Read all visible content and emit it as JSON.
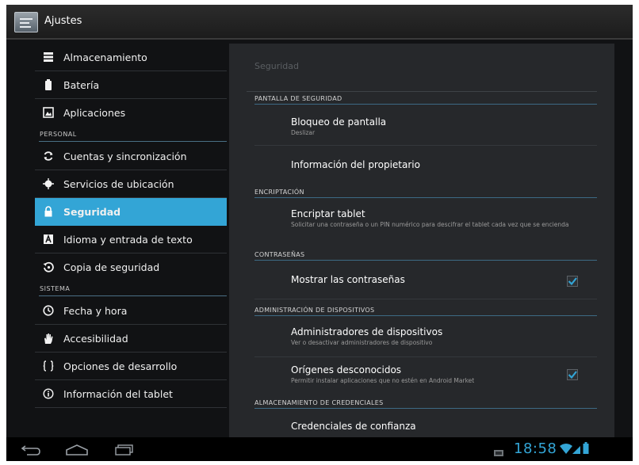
{
  "app": {
    "title": "Ajustes"
  },
  "nav": {
    "items": [
      {
        "label": "Almacenamiento",
        "icon": "storage-icon"
      },
      {
        "label": "Batería",
        "icon": "battery-icon"
      },
      {
        "label": "Aplicaciones",
        "icon": "apps-icon"
      },
      {
        "label": "Cuentas y sincronización",
        "icon": "sync-icon"
      },
      {
        "label": "Servicios de ubicación",
        "icon": "location-icon"
      },
      {
        "label": "Seguridad",
        "icon": "lock-icon",
        "selected": true
      },
      {
        "label": "Idioma y entrada de texto",
        "icon": "language-icon"
      },
      {
        "label": "Copia de seguridad",
        "icon": "backup-icon"
      },
      {
        "label": "Fecha y hora",
        "icon": "clock-icon"
      },
      {
        "label": "Accesibilidad",
        "icon": "hand-icon"
      },
      {
        "label": "Opciones de desarrollo",
        "icon": "braces-icon"
      },
      {
        "label": "Información del tablet",
        "icon": "info-icon"
      }
    ],
    "headers": {
      "personal": "PERSONAL",
      "sistema": "SISTEMA"
    }
  },
  "panel": {
    "title": "Seguridad",
    "sections": {
      "pantalla": "PANTALLA DE SEGURIDAD",
      "encriptacion": "ENCRIPTACIÓN",
      "contrasenas": "CONTRASEÑAS",
      "administracion": "ADMINISTRACIÓN DE DISPOSITIVOS",
      "almacenamiento": "ALMACENAMIENTO DE CREDENCIALES"
    },
    "prefs": {
      "bloqueo": {
        "title": "Bloqueo de pantalla",
        "summary": "Deslizar"
      },
      "propietario": {
        "title": "Información del propietario"
      },
      "encriptar": {
        "title": "Encriptar tablet",
        "summary": "Solicitar una contraseña o un PIN numérico para descifrar el tablet cada vez que se encienda"
      },
      "mostrar": {
        "title": "Mostrar las contraseñas",
        "checked": true
      },
      "administradores": {
        "title": "Administradores de dispositivos",
        "summary": "Ver o desactivar administradores de dispositivo"
      },
      "origenes": {
        "title": "Orígenes desconocidos",
        "summary": "Permitir instalar aplicaciones que no estén en Android Market",
        "checked": true
      },
      "credenciales": {
        "title": "Credenciales de confianza"
      }
    }
  },
  "status": {
    "time": "18:58"
  },
  "colors": {
    "accent": "#33a5d6",
    "background": "#111214",
    "panel": "#26282b"
  }
}
